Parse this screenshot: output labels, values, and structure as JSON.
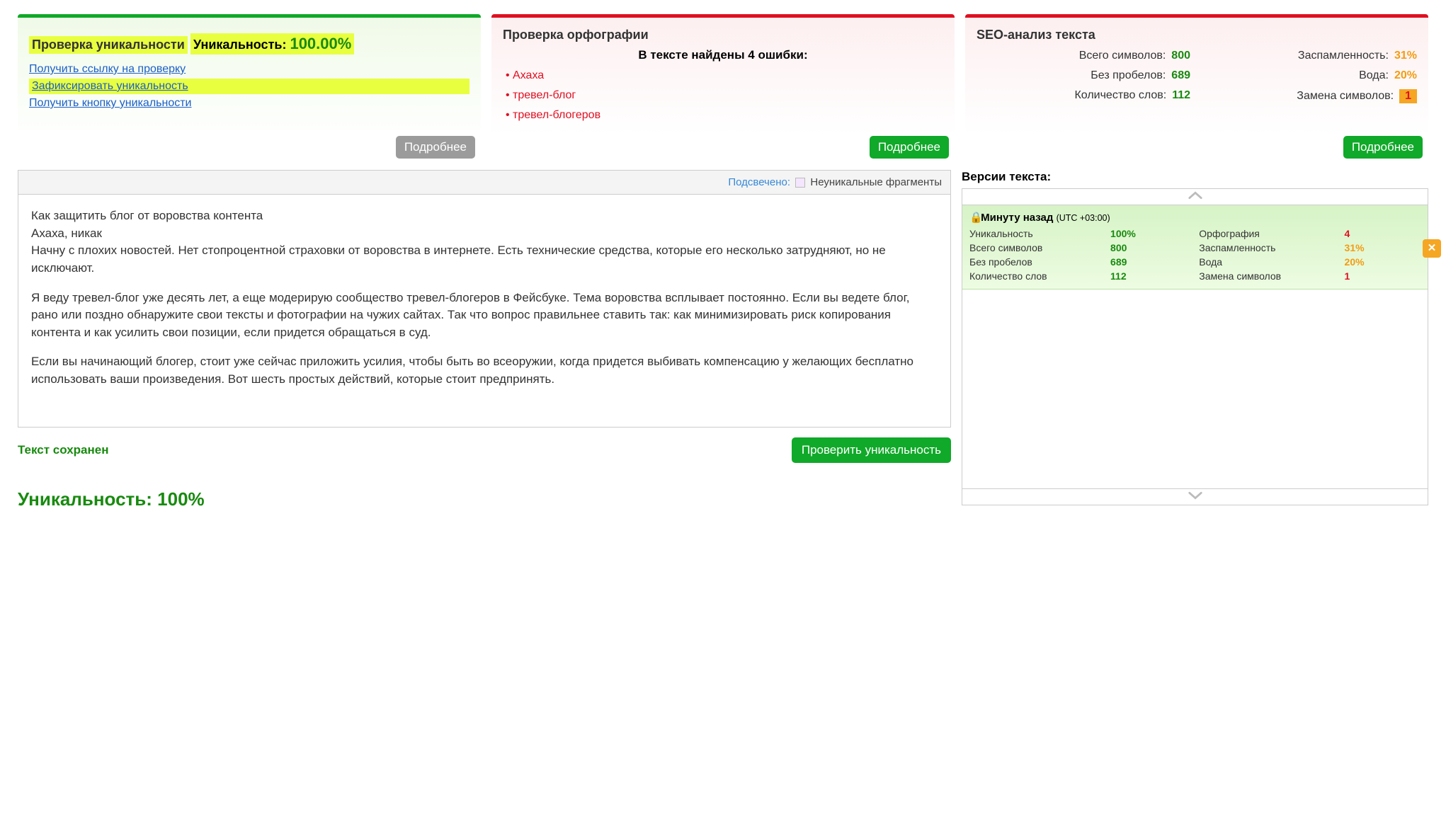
{
  "card_uniq": {
    "title": "Проверка уникальности",
    "label": "Уникальность:",
    "percent": "100.00%",
    "links": {
      "get_link": "Получить ссылку на проверку",
      "fix_uniq": "Зафиксировать уникальность",
      "get_button": "Получить кнопку уникальности"
    },
    "more": "Подробнее"
  },
  "card_spell": {
    "title": "Проверка орфографии",
    "subtitle": "В тексте найдены 4 ошибки:",
    "errors": [
      "Ахаха",
      "тревел-блог",
      "тревел-блогеров"
    ],
    "more": "Подробнее"
  },
  "card_seo": {
    "title": "SEO-анализ текста",
    "left": {
      "r1_l": "Всего символов:",
      "r1_v": "800",
      "r2_l": "Без пробелов:",
      "r2_v": "689",
      "r3_l": "Количество слов:",
      "r3_v": "112"
    },
    "right": {
      "r1_l": "Заспамленность:",
      "r1_v": "31%",
      "r2_l": "Вода:",
      "r2_v": "20%",
      "r3_l": "Замена символов:",
      "r3_v": "1"
    },
    "more": "Подробнее"
  },
  "highlight": {
    "label": "Подсвечено:",
    "text": "Неуникальные фрагменты"
  },
  "text": {
    "p1": "Как защитить блог от воровства контента",
    "p2": "Ахаха, никак",
    "p3": "Начну с плохих новостей. Нет стопроцентной страховки от воровства в интернете. Есть технические средства, которые его несколько затрудняют, но не исключают.",
    "p4": "Я веду тревел-блог уже десять лет, а еще модерирую сообщество тревел-блогеров в Фейсбуке. Тема воровства всплывает постоянно. Если вы ведете блог, рано или поздно обнаружите свои тексты и фотографии на чужих сайтах. Так что вопрос правильнее ставить так: как минимизировать риск копирования контента и как усилить свои позиции, если придется обращаться в суд.",
    "p5": "Если вы начинающий блогер, стоит уже сейчас приложить усилия, чтобы быть во всеоружии, когда придется выбивать компенсацию у желающих бесплатно использовать ваши произведения. Вот шесть простых действий, которые стоит предпринять."
  },
  "saved_label": "Текст сохранен",
  "check_btn": "Проверить уникальность",
  "big_uniq": "Уникальность: 100%",
  "versions": {
    "title": "Версии текста:",
    "item": {
      "time": "Минуту назад",
      "tz": "(UTC +03:00)",
      "stats": {
        "uniq_l": "Уникальность",
        "uniq_v": "100%",
        "orf_l": "Орфография",
        "orf_v": "4",
        "chars_l": "Всего символов",
        "chars_v": "800",
        "spam_l": "Заспамленность",
        "spam_v": "31%",
        "nosp_l": "Без пробелов",
        "nosp_v": "689",
        "water_l": "Вода",
        "water_v": "20%",
        "words_l": "Количество слов",
        "words_v": "112",
        "repl_l": "Замена символов",
        "repl_v": "1"
      }
    }
  }
}
